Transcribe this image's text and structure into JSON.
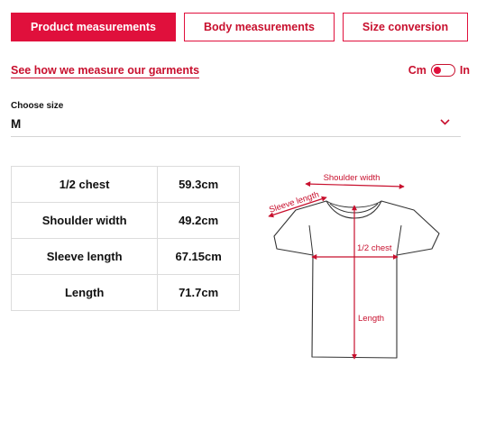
{
  "tabs": [
    {
      "label": "Product measurements",
      "active": true
    },
    {
      "label": "Body measurements",
      "active": false
    },
    {
      "label": "Size conversion",
      "active": false
    }
  ],
  "measure_link": "See how we measure our garments",
  "unit_toggle": {
    "left": "Cm",
    "right": "In",
    "selected": "Cm"
  },
  "size_selector": {
    "label": "Choose size",
    "value": "M"
  },
  "measurements": [
    {
      "name": "1/2 chest",
      "value": "59.3cm"
    },
    {
      "name": "Shoulder width",
      "value": "49.2cm"
    },
    {
      "name": "Sleeve length",
      "value": "67.15cm"
    },
    {
      "name": "Length",
      "value": "71.7cm"
    }
  ],
  "diagram": {
    "shoulder_label": "Shoulder width",
    "sleeve_label": "Sleeve length",
    "chest_label": "1/2 chest",
    "length_label": "Length"
  },
  "colors": {
    "accent": "#e0103c",
    "text": "#111111",
    "border": "#dcdcdc"
  }
}
